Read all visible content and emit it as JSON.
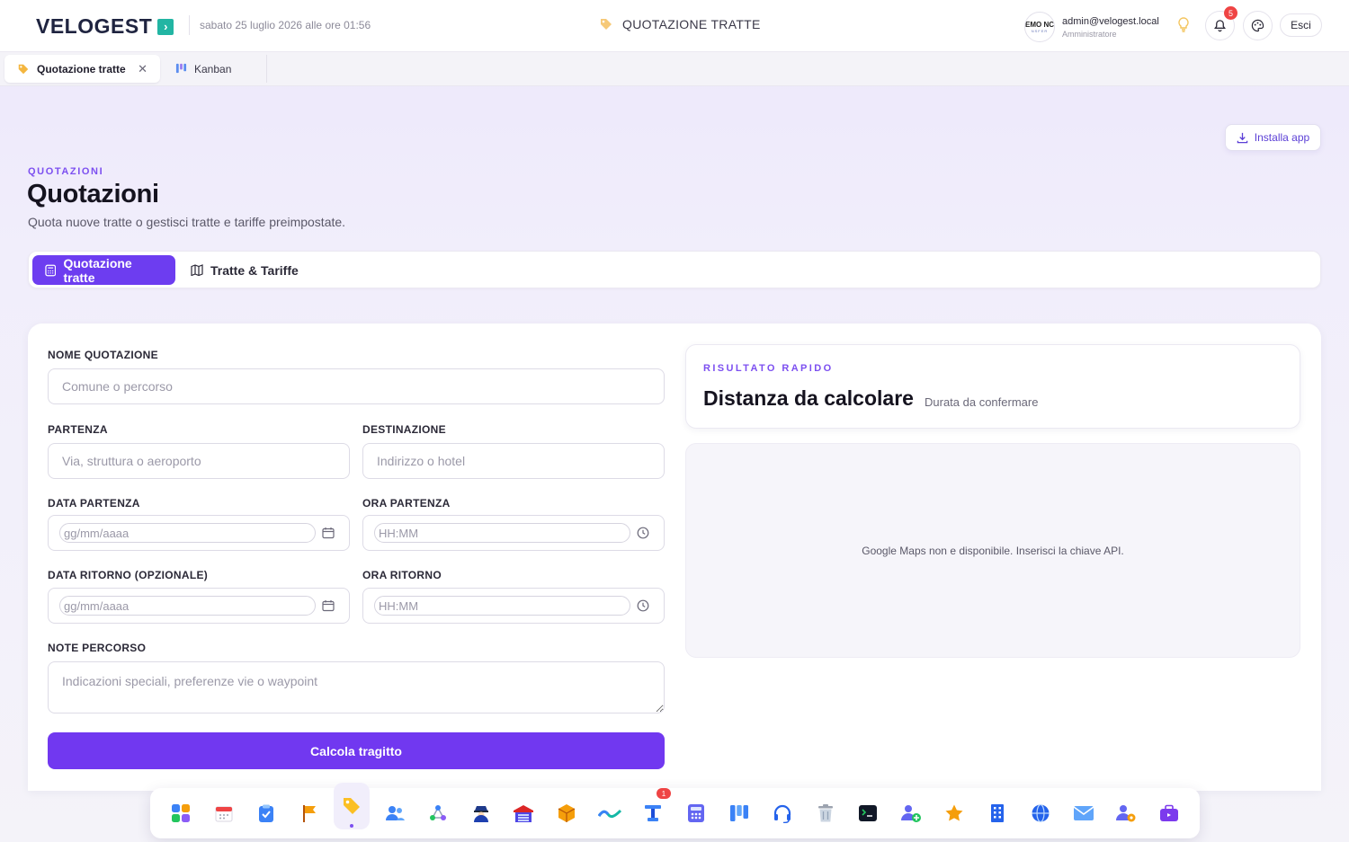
{
  "header": {
    "logo_text": "VELOGEST",
    "logo_mark": "›",
    "datetime": "sabato 25 luglio 2026 alle ore 01:56",
    "section_title": "QUOTAZIONE TRATTE",
    "avatar_line1": "EMO NC",
    "avatar_line2": "NSFER",
    "user_email": "admin@velogest.local",
    "user_role": "Amministratore",
    "notifications_count": "5",
    "logout_label": "Esci"
  },
  "tabs": [
    {
      "label": "Quotazione tratte",
      "icon": "tag-icon",
      "active": true
    },
    {
      "label": "Kanban",
      "icon": "kanban-icon",
      "active": false
    }
  ],
  "install_label": "Installa app",
  "page": {
    "eyebrow": "QUOTAZIONI",
    "title": "Quotazioni",
    "subtitle": "Quota nuove tratte o gestisci tratte e tariffe preimpostate."
  },
  "section_tabs": [
    {
      "label": "Quotazione tratte",
      "icon": "calculator-icon",
      "active": true
    },
    {
      "label": "Tratte & Tariffe",
      "icon": "map-icon",
      "active": false
    }
  ],
  "form": {
    "name_label": "NOME QUOTAZIONE",
    "name_placeholder": "Comune o percorso",
    "from_label": "PARTENZA",
    "from_placeholder": "Via, struttura o aeroporto",
    "to_label": "DESTINAZIONE",
    "to_placeholder": "Indirizzo o hotel",
    "date_dep_label": "DATA PARTENZA",
    "date_placeholder": "gg/mm/aaaa",
    "time_dep_label": "ORA PARTENZA",
    "time_placeholder": "HH:MM",
    "date_ret_label": "DATA RITORNO (OPZIONALE)",
    "time_ret_label": "ORA RITORNO",
    "notes_label": "NOTE PERCORSO",
    "notes_placeholder": "Indicazioni speciali, preferenze vie o waypoint",
    "submit_label": "Calcola tragitto"
  },
  "result": {
    "eyebrow": "RISULTATO RAPIDO",
    "title": "Distanza da calcolare",
    "subtitle": "Durata da confermare",
    "map_message": "Google Maps non e disponibile. Inserisci la chiave API."
  },
  "dock": [
    {
      "icon": "apps-grid-icon"
    },
    {
      "icon": "calendar-icon"
    },
    {
      "icon": "clipboard-check-icon"
    },
    {
      "icon": "flag-icon"
    },
    {
      "icon": "tag-icon",
      "active": true
    },
    {
      "icon": "users-icon"
    },
    {
      "icon": "network-icon"
    },
    {
      "icon": "agent-icon"
    },
    {
      "icon": "garage-icon"
    },
    {
      "icon": "package-icon"
    },
    {
      "icon": "route-icon"
    },
    {
      "icon": "transfer-icon",
      "badge": "1"
    },
    {
      "icon": "calculator-icon"
    },
    {
      "icon": "kanban-icon"
    },
    {
      "icon": "headset-icon"
    },
    {
      "icon": "trash-icon"
    },
    {
      "icon": "terminal-icon"
    },
    {
      "icon": "add-user-icon"
    },
    {
      "icon": "star-icon"
    },
    {
      "icon": "building-icon"
    },
    {
      "icon": "globe-icon"
    },
    {
      "icon": "mail-icon"
    },
    {
      "icon": "user-settings-icon"
    },
    {
      "icon": "briefcase-icon"
    }
  ],
  "colors": {
    "accent": "#6d3df0",
    "button": "#7138f0",
    "eyebrow": "#7c4ff0",
    "badge": "#ef4444",
    "logo_mark": "#22b5a3"
  }
}
